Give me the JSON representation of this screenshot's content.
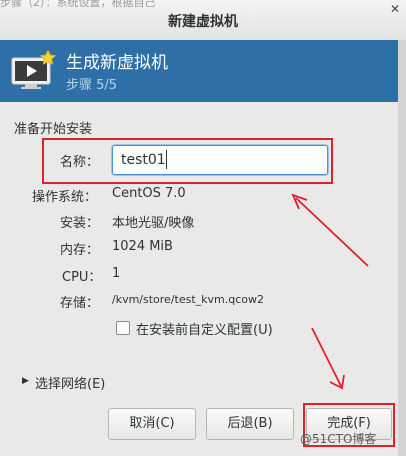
{
  "window": {
    "title": "新建虚拟机",
    "background_text": "步骤（2）：系统设置，根据自己"
  },
  "header": {
    "title": "生成新虚拟机",
    "step": "步骤 5/5"
  },
  "section": {
    "label": "准备开始安装"
  },
  "name": {
    "label": "名称：",
    "value": "test01"
  },
  "info": {
    "os_label": "操作系统：",
    "os_value": "CentOS 7.0",
    "install_label": "安装：",
    "install_value": "本地光驱/映像",
    "memory_label": "内存：",
    "memory_value": "1024 MiB",
    "cpu_label": "CPU：",
    "cpu_value": "1",
    "storage_label": "存储：",
    "storage_value": "/kvm/store/test_kvm.qcow2"
  },
  "customize": {
    "label": "在安装前自定义配置(U)",
    "checked": false
  },
  "network": {
    "label": "选择网络(E)",
    "expanded": false
  },
  "buttons": {
    "cancel": "取消(C)",
    "back": "后退(B)",
    "finish": "完成(F)"
  },
  "watermark": "@51CTO博客",
  "colors": {
    "header_bg": "#2e6fa8",
    "annotation_red": "#e0202a",
    "focus_blue": "#4a90d9"
  }
}
